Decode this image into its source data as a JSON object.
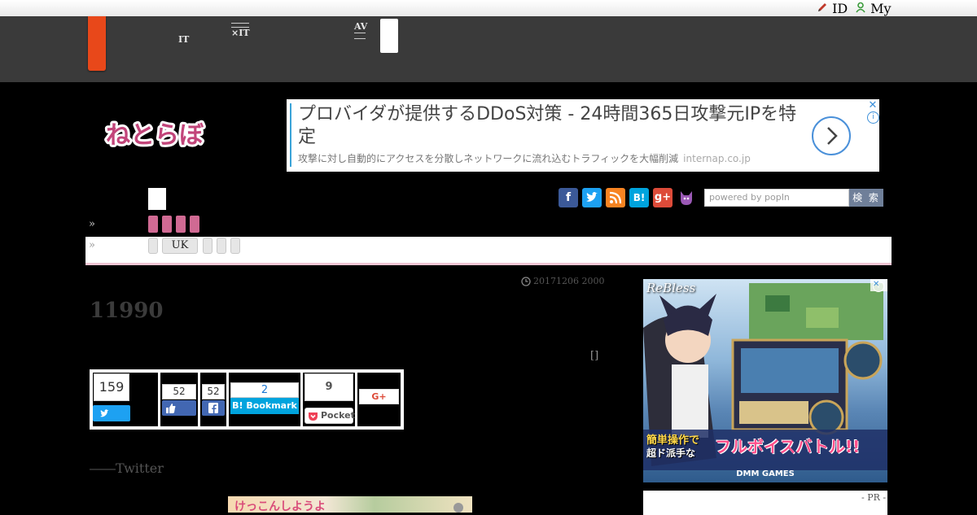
{
  "topbar": {
    "id_label": "ID",
    "my_label": "My"
  },
  "nav": {
    "item1_line1": " ",
    "item1_line2": "IT",
    "item2_line1": " ",
    "item2_line2": "×IT",
    "item3_line1": "AV",
    "item3_line2": " "
  },
  "ad": {
    "title": "プロバイダが提供するDDoS対策 - 24時間365日攻撃元IPを特定",
    "description": "攻撃に対し自動的にアクセスを分散しネットワークに流れ込むトラフィックを大幅削減",
    "domain": "internap.co.jp",
    "close_glyph": "✕",
    "info_glyph": "i"
  },
  "logo_text": "ねとらぼ",
  "social": {
    "facebook": "f",
    "twitter": "t",
    "rss": "rss",
    "hatena": "B!",
    "gplus": "g+",
    "cat": "cat"
  },
  "search": {
    "placeholder": "powered by popIn",
    "button": "検 索"
  },
  "subnav": {
    "arrow": "»",
    "tag_uk": "UK"
  },
  "article": {
    "date": "20171206 2000",
    "title": "11990",
    "bracket": "[]",
    "twitter_line": "――Twitter"
  },
  "share": {
    "tweet_count": "159",
    "like_count": "52",
    "fb_count": "52",
    "hatena_count": "2",
    "hatena_label": "Bookmark",
    "pocket_count": "9",
    "pocket_label": "Pocket",
    "gplus_label": "G+"
  },
  "game_ad": {
    "brand": "ReBless",
    "catch_line1": "簡単操作で",
    "catch_line2": "超ド派手な",
    "catch_line3": "フルボイスバトル!!",
    "publisher": "DMM GAMES"
  },
  "pr_label": "- PR -",
  "tweet_image_text": "けっこんしようよ",
  "colors": {
    "header_bg": "#3a3a3a",
    "orange": "#e8481a",
    "pink": "#d06a93",
    "twitter": "#1da1f2",
    "facebook": "#3b5998",
    "hatena": "#00a4de",
    "pocket": "#ef4056"
  }
}
